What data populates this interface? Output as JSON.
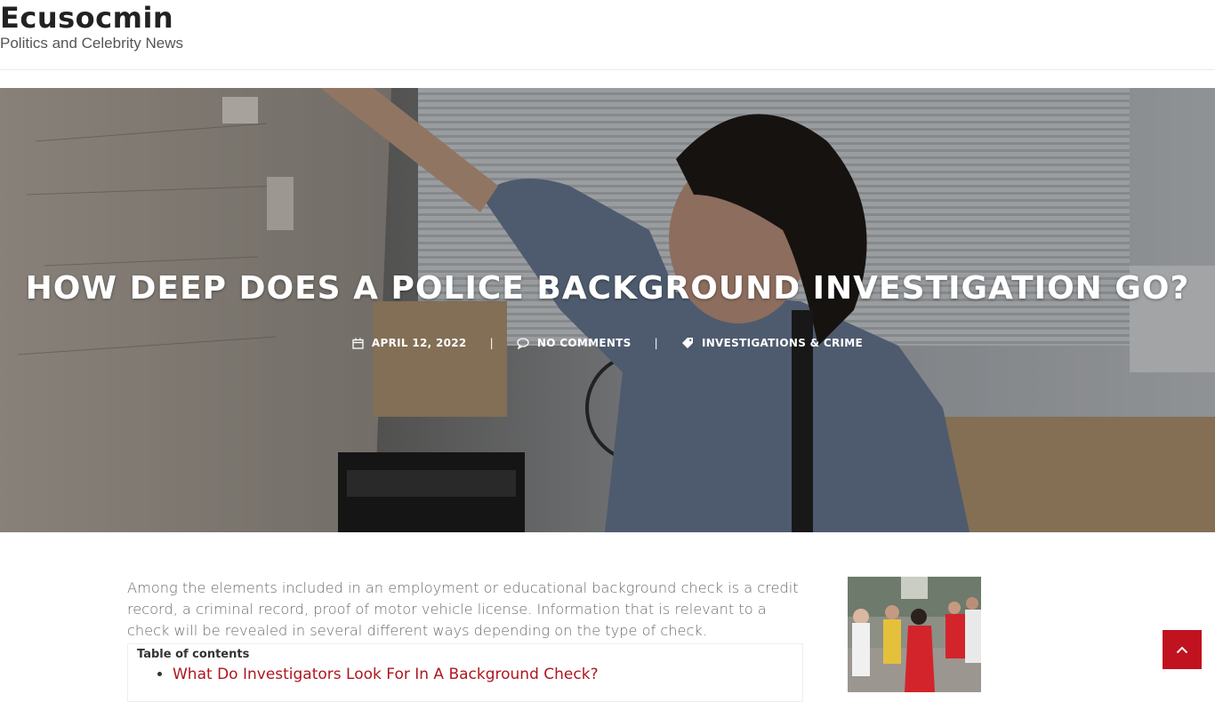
{
  "header": {
    "site_title": "Ecusocmin",
    "tagline": "Politics and Celebrity News"
  },
  "hero": {
    "title": "HOW DEEP DOES A POLICE BACKGROUND INVESTIGATION GO?",
    "meta": {
      "date": "APRIL 12, 2022",
      "comments": "NO COMMENTS",
      "category": "INVESTIGATIONS & CRIME",
      "separator": "|"
    }
  },
  "article": {
    "intro": "Among the elements included in an employment or educational background check is a credit record, a criminal record, proof of motor vehicle license. Information that is relevant to a check will be revealed in several different ways depending on the type of check.",
    "toc": {
      "title": "Table of contents",
      "items": [
        "What Do Investigators Look For In A Background Check?"
      ]
    }
  },
  "colors": {
    "accent": "#c1121f",
    "link": "#b0161d"
  },
  "icons": {
    "date": "calendar-icon",
    "comments": "comment-icon",
    "category": "tag-icon",
    "back_to_top": "chevron-up-icon"
  }
}
